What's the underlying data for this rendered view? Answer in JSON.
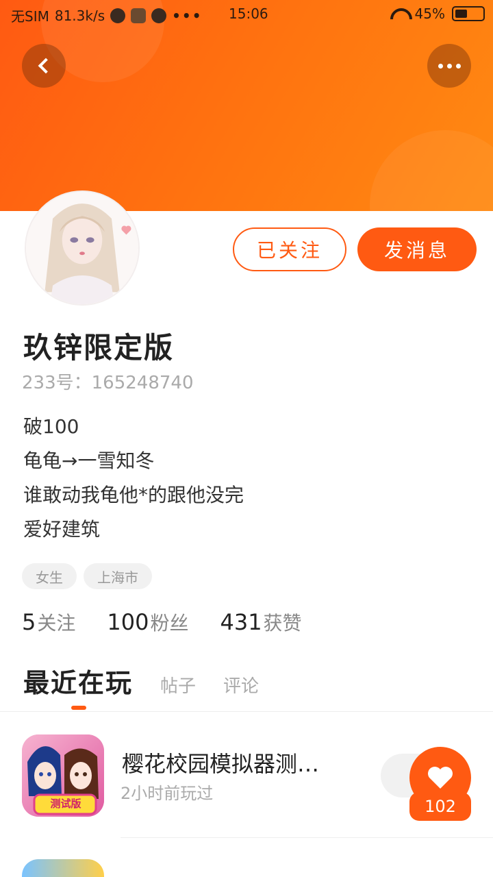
{
  "status_bar": {
    "carrier": "无SIM",
    "speed": "81.3k/s",
    "extra": "•••",
    "time": "15:06",
    "battery": "45%",
    "battery_level": 0.45
  },
  "profile": {
    "name": "玖锌限定版",
    "uid": "233号：165248740",
    "bio": [
      "破100",
      "龟龟→一雪知冬",
      "谁敢动我龟他*的跟他没完",
      "爱好建筑"
    ],
    "tags": [
      "女生",
      "上海市"
    ],
    "follow_label": "已关注",
    "message_label": "发消息"
  },
  "stats": [
    {
      "num": "5",
      "label": "关注"
    },
    {
      "num": "100",
      "label": "粉丝"
    },
    {
      "num": "431",
      "label": "获赞"
    }
  ],
  "tabs": [
    "最近在玩",
    "帖子",
    "评论"
  ],
  "games": [
    {
      "title": "樱花校园模拟器测…",
      "subtitle": "2小时前玩过",
      "badge": "测试版"
    }
  ],
  "like": {
    "count": "102"
  },
  "colors": {
    "accent": "#ff5a12",
    "header": "#ff7310"
  }
}
